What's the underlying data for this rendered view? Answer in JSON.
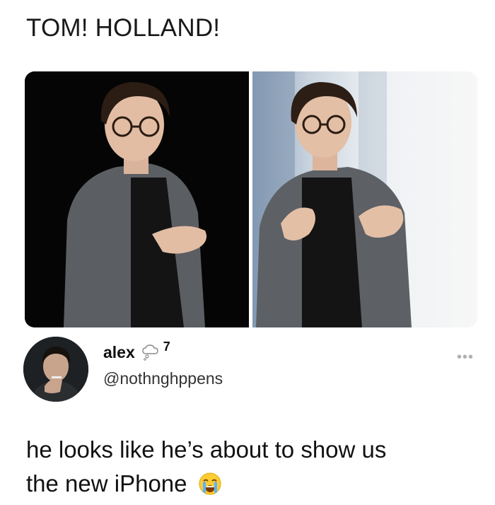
{
  "post": {
    "title": "TOM! HOLLAND!"
  },
  "photos": [
    {
      "name": "photo-left",
      "subject": "man in glasses and grey blazer presenting on dark stage"
    },
    {
      "name": "photo-right",
      "subject": "man in glasses and grey blazer presenting on bright stage"
    }
  ],
  "tweet": {
    "display_name": "alex",
    "badge_icon": "thought-bubble-icon",
    "badge_count": "7",
    "handle": "@nothnghppens",
    "more_icon": "more-dots-icon",
    "text_line1": "he looks like he’s about to show us",
    "text_line2": "the new iPhone",
    "emoji": "loudly-crying-face-icon"
  },
  "colors": {
    "background": "#ffffff",
    "text": "#111111",
    "muted": "#b0b0b0"
  }
}
